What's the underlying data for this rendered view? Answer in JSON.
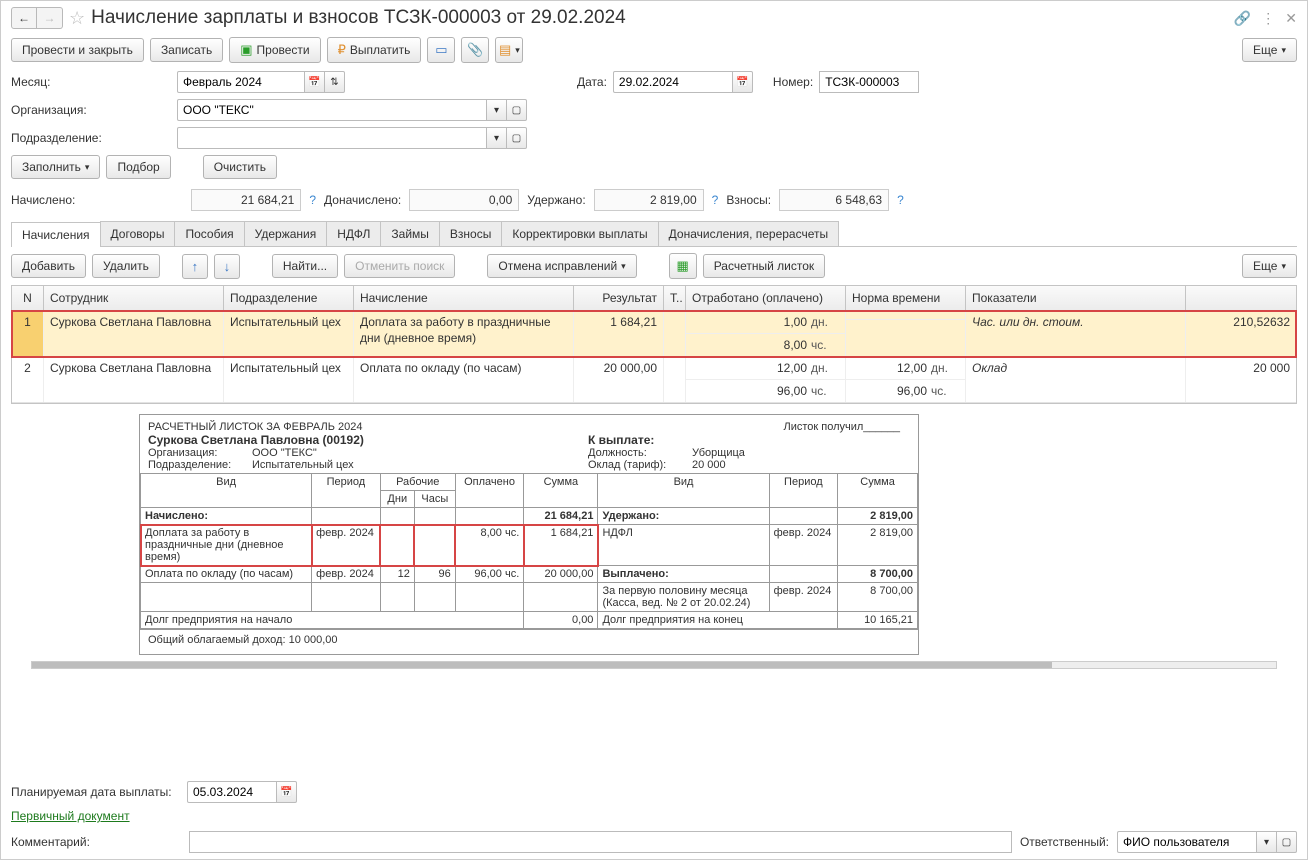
{
  "header": {
    "title": "Начисление зарплаты и взносов ТСЗК-000003 от 29.02.2024"
  },
  "toolbar": {
    "post_and_close": "Провести и закрыть",
    "save": "Записать",
    "post": "Провести",
    "pay": "Выплатить",
    "more": "Еще"
  },
  "fields": {
    "month_label": "Месяц:",
    "month_value": "Февраль 2024",
    "date_label": "Дата:",
    "date_value": "29.02.2024",
    "number_label": "Номер:",
    "number_value": "ТСЗК-000003",
    "org_label": "Организация:",
    "org_value": "ООО \"ТЕКС\"",
    "dept_label": "Подразделение:",
    "dept_value": ""
  },
  "actions": {
    "fill": "Заполнить",
    "select": "Подбор",
    "clear": "Очистить"
  },
  "totals": {
    "accrued_lbl": "Начислено:",
    "accrued_val": "21 684,21",
    "recalc_lbl": "Доначислено:",
    "recalc_val": "0,00",
    "withheld_lbl": "Удержано:",
    "withheld_val": "2 819,00",
    "contrib_lbl": "Взносы:",
    "contrib_val": "6 548,63"
  },
  "tabs": [
    "Начисления",
    "Договоры",
    "Пособия",
    "Удержания",
    "НДФЛ",
    "Займы",
    "Взносы",
    "Корректировки выплаты",
    "Доначисления, перерасчеты"
  ],
  "sub_toolbar": {
    "add": "Добавить",
    "delete": "Удалить",
    "find": "Найти...",
    "cancel_search": "Отменить поиск",
    "cancel_fix": "Отмена исправлений",
    "payslip": "Расчетный листок",
    "more": "Еще"
  },
  "grid": {
    "head": {
      "n": "N",
      "emp": "Сотрудник",
      "dept": "Подразделение",
      "acc": "Начисление",
      "res": "Результат",
      "t": "Т..",
      "work": "Отработано (оплачено)",
      "norm": "Норма времени",
      "ind": "Показатели",
      "indval": ""
    },
    "rows": [
      {
        "n": "1",
        "emp": "Суркова Светлана Павловна",
        "dept": "Испытательный цех",
        "acc": "Доплата за работу в праздничные дни (дневное время)",
        "res": "1 684,21",
        "work": [
          {
            "val": "1,00",
            "unit": "дн."
          },
          {
            "val": "8,00",
            "unit": "чс."
          }
        ],
        "norm": [],
        "ind": "Час. или дн. стоим.",
        "indval": "210,52632",
        "selected": true
      },
      {
        "n": "2",
        "emp": "Суркова Светлана Павловна",
        "dept": "Испытательный цех",
        "acc": "Оплата по окладу (по часам)",
        "res": "20 000,00",
        "work": [
          {
            "val": "12,00",
            "unit": "дн."
          },
          {
            "val": "96,00",
            "unit": "чс."
          }
        ],
        "norm": [
          {
            "val": "12,00",
            "unit": "дн."
          },
          {
            "val": "96,00",
            "unit": "чс."
          }
        ],
        "ind": "Оклад",
        "indval": "20 000",
        "selected": false
      }
    ]
  },
  "payslip": {
    "title": "РАСЧЕТНЫЙ ЛИСТОК ЗА ФЕВРАЛЬ 2024",
    "received": "Листок получил______",
    "employee": "Суркова Светлана Павловна (00192)",
    "pay_label": "К выплате:",
    "org_lbl": "Организация:",
    "org_val": "ООО \"ТЕКС\"",
    "dept_lbl": "Подразделение:",
    "dept_val": "Испытательный цех",
    "position_lbl": "Должность:",
    "position_val": "Уборщица",
    "salary_lbl": "Оклад (тариф):",
    "salary_val": "20 000",
    "head_left": {
      "kind": "Вид",
      "period": "Период",
      "days": "Дни",
      "hours": "Часы",
      "workgroup": "Рабочие",
      "paid": "Оплачено",
      "sum": "Сумма"
    },
    "head_right": {
      "kind": "Вид",
      "period": "Период",
      "sum": "Сумма"
    },
    "accrued_lbl": "Начислено:",
    "accrued_sum": "21 684,21",
    "withheld_lbl": "Удержано:",
    "withheld_sum": "2 819,00",
    "left_rows": [
      {
        "kind": "Доплата за работу в праздничные дни (дневное время)",
        "period": "февр. 2024",
        "days": "",
        "hours": "",
        "paid": "8,00 чс.",
        "sum": "1 684,21",
        "hl": true
      },
      {
        "kind": "Оплата по окладу (по часам)",
        "period": "февр. 2024",
        "days": "12",
        "hours": "96",
        "paid": "96,00 чс.",
        "sum": "20 000,00",
        "hl": false
      }
    ],
    "right_rows": [
      {
        "kind": "НДФЛ",
        "period": "февр. 2024",
        "sum": "2 819,00"
      }
    ],
    "paid_lbl": "Выплачено:",
    "paid_sum": "8 700,00",
    "paid_rows": [
      {
        "kind": "За первую половину месяца (Касса, вед. № 2 от 20.02.24)",
        "period": "февр. 2024",
        "sum": "8 700,00"
      }
    ],
    "debt_start_lbl": "Долг предприятия на начало",
    "debt_start_val": "0,00",
    "debt_end_lbl": "Долг предприятия на конец",
    "debt_end_val": "10 165,21",
    "taxable": "Общий облагаемый доход: 10 000,00"
  },
  "footer": {
    "paydate_lbl": "Планируемая дата выплаты:",
    "paydate_val": "05.03.2024",
    "primary_doc": "Первичный документ",
    "comment_lbl": "Комментарий:",
    "comment_val": "",
    "resp_lbl": "Ответственный:",
    "resp_val": "ФИО пользователя"
  }
}
